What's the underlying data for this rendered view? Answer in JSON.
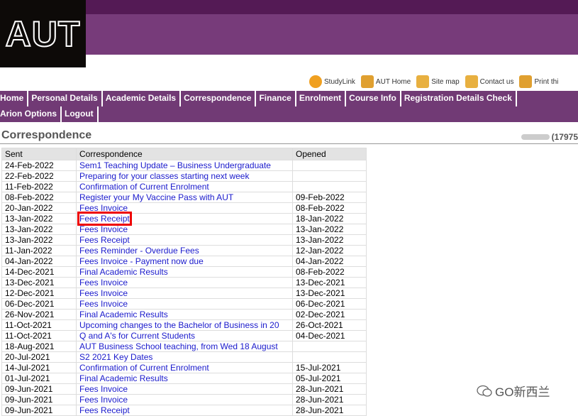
{
  "logo": "AUT",
  "colors": {
    "top_bar": "#541a55",
    "banner": "#773b7a",
    "nav": "#713a75",
    "link": "#1a1acc",
    "highlight": "#e00000"
  },
  "toolbar": [
    {
      "label": "StudyLink",
      "icon": "studylink-icon",
      "color": "#f0a020"
    },
    {
      "label": "AUT Home",
      "icon": "home-icon",
      "color": "#e0a030"
    },
    {
      "label": "Site map",
      "icon": "sitemap-icon",
      "color": "#e8b040"
    },
    {
      "label": "Contact us",
      "icon": "phone-icon",
      "color": "#e8b040"
    },
    {
      "label": "Print thi",
      "icon": "print-icon",
      "color": "#e0a030"
    }
  ],
  "nav": {
    "row1": [
      "Home",
      "Personal Details",
      "Academic Details",
      "Correspondence",
      "Finance",
      "Enrolment",
      "Course Info",
      "Registration Details Check",
      "Arion Options"
    ],
    "row2": [
      "Logout"
    ]
  },
  "page_title": "Correspondence",
  "user_id": "(17975",
  "table": {
    "headers": [
      "Sent",
      "Correspondence",
      "Opened"
    ],
    "rows": [
      [
        "24-Feb-2022",
        "Sem1 Teaching Update – Business Undergraduate",
        ""
      ],
      [
        "22-Feb-2022",
        "Preparing for your classes starting next week",
        ""
      ],
      [
        "11-Feb-2022",
        "Confirmation of Current Enrolment",
        ""
      ],
      [
        "08-Feb-2022",
        "Register your My Vaccine Pass with AUT",
        "09-Feb-2022"
      ],
      [
        "20-Jan-2022",
        "Fees Invoice",
        "08-Feb-2022"
      ],
      [
        "13-Jan-2022",
        "Fees Receipt",
        "18-Jan-2022"
      ],
      [
        "13-Jan-2022",
        "Fees Invoice",
        "13-Jan-2022"
      ],
      [
        "13-Jan-2022",
        "Fees Receipt",
        "13-Jan-2022"
      ],
      [
        "11-Jan-2022",
        "Fees Reminder - Overdue Fees",
        "12-Jan-2022"
      ],
      [
        "04-Jan-2022",
        "Fees Invoice - Payment now due",
        "04-Jan-2022"
      ],
      [
        "14-Dec-2021",
        "Final Academic Results",
        "08-Feb-2022"
      ],
      [
        "13-Dec-2021",
        "Fees Invoice",
        "13-Dec-2021"
      ],
      [
        "12-Dec-2021",
        "Fees Invoice",
        "13-Dec-2021"
      ],
      [
        "06-Dec-2021",
        "Fees Invoice",
        "06-Dec-2021"
      ],
      [
        "26-Nov-2021",
        "Final Academic Results",
        "02-Dec-2021"
      ],
      [
        "11-Oct-2021",
        "Upcoming changes to the Bachelor of Business in 20",
        "26-Oct-2021"
      ],
      [
        "11-Oct-2021",
        "Q and A's for Current Students",
        "04-Dec-2021"
      ],
      [
        "18-Aug-2021",
        "AUT Business School teaching, from Wed 18 August",
        ""
      ],
      [
        "20-Jul-2021",
        "S2 2021 Key Dates",
        ""
      ],
      [
        "14-Jul-2021",
        "Confirmation of Current Enrolment",
        "15-Jul-2021"
      ],
      [
        "01-Jul-2021",
        "Final Academic Results",
        "05-Jul-2021"
      ],
      [
        "09-Jun-2021",
        "Fees Invoice",
        "28-Jun-2021"
      ],
      [
        "09-Jun-2021",
        "Fees Invoice",
        "28-Jun-2021"
      ],
      [
        "09-Jun-2021",
        "Fees Receipt",
        "28-Jun-2021"
      ]
    ],
    "highlighted_row": 5
  },
  "watermark": "GO新西兰"
}
